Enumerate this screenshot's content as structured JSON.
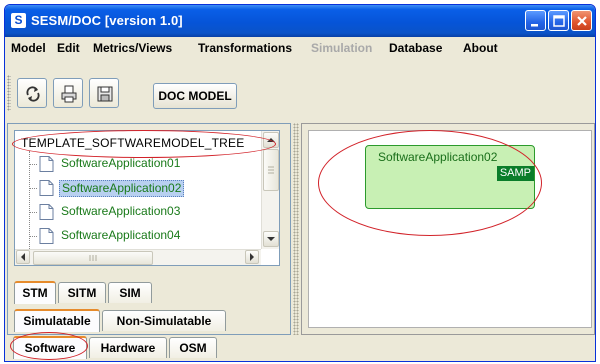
{
  "window": {
    "title": "SESM/DOC [version 1.0]",
    "logo_letter": "S"
  },
  "menu": [
    "Model",
    "Edit",
    "Metrics/Views",
    "Transformations",
    "Simulation",
    "Database",
    "About"
  ],
  "toolbar": {
    "buttons": [
      "refresh-icon",
      "print-icon",
      "save-icon"
    ],
    "doc_model_label": "DOC MODEL"
  },
  "tree": {
    "root": "TEMPLATE_SOFTWAREMODEL_TREE",
    "items": [
      "SoftwareApplication01",
      "SoftwareApplication02",
      "SoftwareApplication03",
      "SoftwareApplication04"
    ],
    "selected_index": 1
  },
  "model_tabs": [
    "STM",
    "SITM",
    "SIM"
  ],
  "sim_tabs": [
    "Simulatable",
    "Non-Simulatable"
  ],
  "bottom_tabs": [
    "Software",
    "Hardware",
    "OSM"
  ],
  "canvas": {
    "node_title": "SoftwareApplication02",
    "node_badge": "SAMP"
  },
  "colors": {
    "annotation": "#d2232a",
    "node_fill": "#c8f0b4",
    "node_badge": "#0a7d2a",
    "tree_text": "#1a7a1a",
    "title_bar": "#0654d8"
  }
}
